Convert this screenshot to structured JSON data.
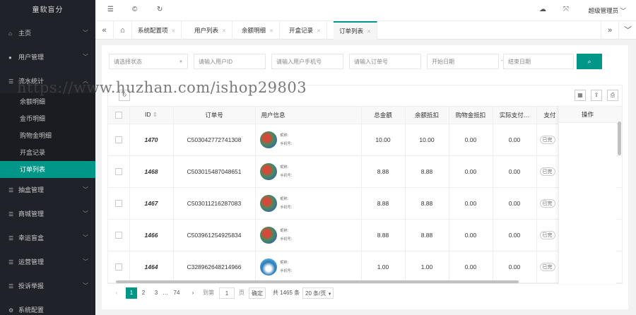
{
  "app": {
    "logo": "童软盲分"
  },
  "sidebar": {
    "items": [
      {
        "label": "主页",
        "icon": "home-icon",
        "glyph": "⌂"
      },
      {
        "label": "用户管理",
        "icon": "users-icon",
        "glyph": "👥"
      },
      {
        "label": "流水统计",
        "icon": "list-icon",
        "glyph": "☰"
      }
    ],
    "sub_items": [
      "余额明细",
      "金币明细",
      "购物金明细",
      "开盒记录",
      "订单列表"
    ],
    "items_after": [
      {
        "label": "抽盒管理",
        "icon": "list-icon",
        "glyph": "☰"
      },
      {
        "label": "商城管理",
        "icon": "list-icon",
        "glyph": "☰"
      },
      {
        "label": "幸运盲盒",
        "icon": "list-icon",
        "glyph": "☰"
      },
      {
        "label": "运营管理",
        "icon": "list-icon",
        "glyph": "☰"
      },
      {
        "label": "投诉举报",
        "icon": "list-icon",
        "glyph": "☰"
      },
      {
        "label": "系统配置",
        "icon": "gear-icon",
        "glyph": "⚙"
      }
    ]
  },
  "topbar": {
    "user": "超级管理员"
  },
  "tabs": [
    "系统配置项",
    "用户列表",
    "余额明细",
    "开盒记录",
    "订单列表"
  ],
  "filters": {
    "status": "请选择状态",
    "user_id": "请输入用户ID",
    "phone": "请输入用户手机号",
    "order_no": "请输入订单号",
    "start": "开始日期",
    "dash": "-",
    "end": "结束日期"
  },
  "table": {
    "columns": [
      "ID",
      "订单号",
      "用户信息",
      "总金额",
      "余额抵扣",
      "购物金抵扣",
      "实际支付…",
      "支付"
    ],
    "op_header": "操作",
    "rows": [
      {
        "id": "1470",
        "order": "C503042772741308",
        "nick": "昵称：",
        "phone": "手机号：",
        "total": "10.00",
        "bal": "10.00",
        "shop": "0.00",
        "paid": "0.00",
        "status": "已完"
      },
      {
        "id": "1468",
        "order": "C503015487048651",
        "nick": "昵称：",
        "phone": "手机号：",
        "total": "8.88",
        "bal": "8.88",
        "shop": "0.00",
        "paid": "0.00",
        "status": "已完"
      },
      {
        "id": "1467",
        "order": "C503011216287083",
        "nick": "昵称：",
        "phone": "手机号：",
        "total": "8.88",
        "bal": "8.88",
        "shop": "0.00",
        "paid": "0.00",
        "status": "已完"
      },
      {
        "id": "1466",
        "order": "C503961254925834",
        "nick": "昵称：",
        "phone": "手机号：",
        "total": "8.88",
        "bal": "8.88",
        "shop": "0.00",
        "paid": "0.00",
        "status": "已完"
      },
      {
        "id": "1464",
        "order": "C328962648214966",
        "nick": "昵称：",
        "phone": "手机号：",
        "total": "1.00",
        "bal": "1.00",
        "shop": "0.00",
        "paid": "0.00",
        "status": "已完"
      }
    ]
  },
  "pager": {
    "prev": "‹",
    "p1": "1",
    "p2": "2",
    "p3": "3",
    "ellipsis": "…",
    "last": "74",
    "next": "›",
    "goto_label": "到第",
    "goto_value": "1",
    "page_unit": "页",
    "go": "确定",
    "total": "共 1465 条",
    "size": "20 条/页"
  },
  "watermark": "https://www.huzhan.com/ishop29803",
  "colors": {
    "accent": "#009688",
    "sidebar_bg": "#20222a"
  }
}
